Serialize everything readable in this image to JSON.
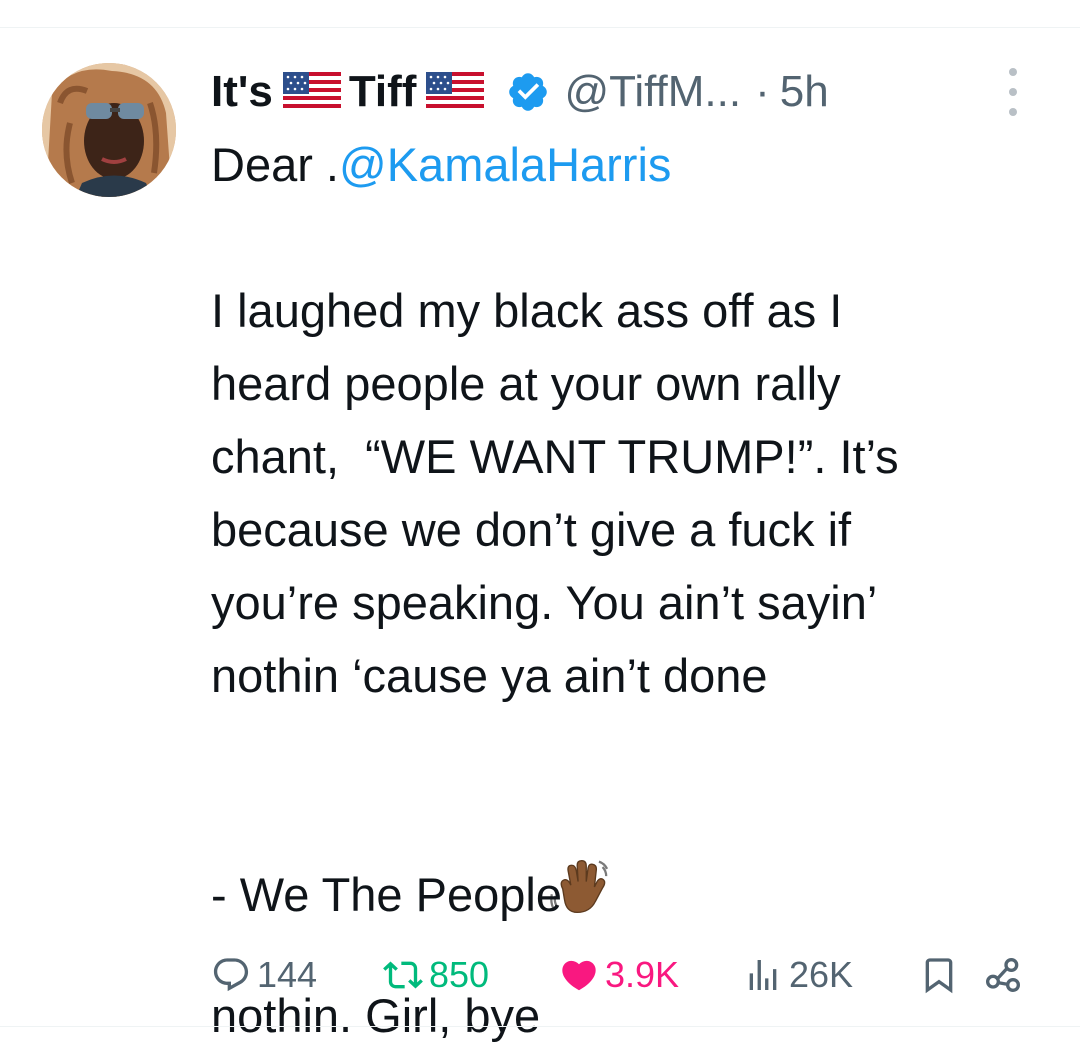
{
  "tweet": {
    "display_name_part1": "It's",
    "display_name_part2": "Tiff",
    "handle": "@TiffM...",
    "separator": "·",
    "time": "5h",
    "flag_icon": "us-flag-icon",
    "verified_icon": "verified-badge-icon",
    "body": {
      "line1_prefix": "Dear .",
      "line1_mention": "@KamalaHarris",
      "line2": "",
      "line3": "I laughed my black ass off as I",
      "line4": "heard people at your own rally",
      "line5": "chant,  “WE WANT TRUMP!”. It’s",
      "line6": "because we don’t give a fuck if",
      "line7": "you’re speaking. You ain’t sayin’",
      "line8": "nothin ‘cause ya ain’t done",
      "line9": "nothin. Girl, bye",
      "line10": "",
      "line11": "- We The People"
    },
    "emoji": "waving-hand-medium-dark-skin-icon",
    "actions": {
      "replies": "144",
      "retweets": "850",
      "likes": "3.9K",
      "views": "26K"
    },
    "colors": {
      "link": "#1d9bf0",
      "muted": "#536471",
      "retweet": "#00ba7c",
      "like": "#f91880",
      "verified": "#1d9bf0"
    }
  }
}
